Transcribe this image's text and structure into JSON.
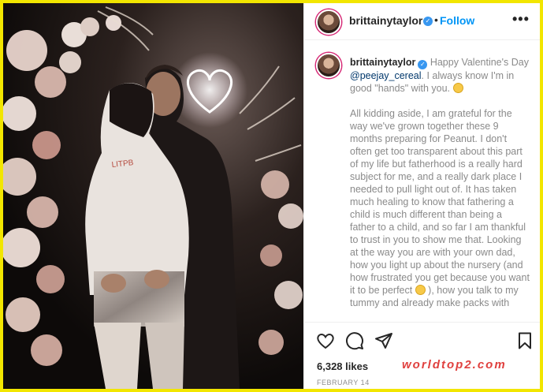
{
  "post": {
    "author": {
      "username": "brittainytaylor",
      "verified": true,
      "follow_label": "Follow",
      "separator": "•",
      "more_label": "•••"
    },
    "caption": {
      "username": "brittainytaylor",
      "text_before_mention": " Happy Valentine's Day ",
      "mention": "@peejay_cereal",
      "text_after_mention": ". I always know I'm in good \"hands\" with you. ",
      "paragraph_2_part_1": "All kidding aside, I am grateful for the way we've grown together these 9 months preparing for Peanut. I don't often get too transparent about this part of my life but fatherhood is a really hard subject for me, and a really dark place I needed to pull light out of. It has taken much healing to know that fathering a child is much different than being a father to a child, and so far I am thankful to trust in you to show me that. Looking at the way you are with your own dad, how you light up about the nursery (and how frustrated you get because you want it to be perfect ",
      "paragraph_2_part_2": " ), how you talk to my tummy and already make packs with"
    },
    "likes": "6,328 likes",
    "date": "FEBRUARY 14",
    "watermark": "worldtop2.com"
  },
  "icons": {
    "like": "heart-icon",
    "comment": "comment-icon",
    "share": "paper-plane-icon",
    "save": "bookmark-icon",
    "verified": "verified-badge-icon",
    "smile": "smiley-emoji",
    "grin": "grinning-emoji"
  },
  "colors": {
    "frame": "#f2e600",
    "follow": "#0095f6",
    "verified": "#3897f0",
    "mention": "#00376b",
    "watermark": "#e0403e"
  }
}
